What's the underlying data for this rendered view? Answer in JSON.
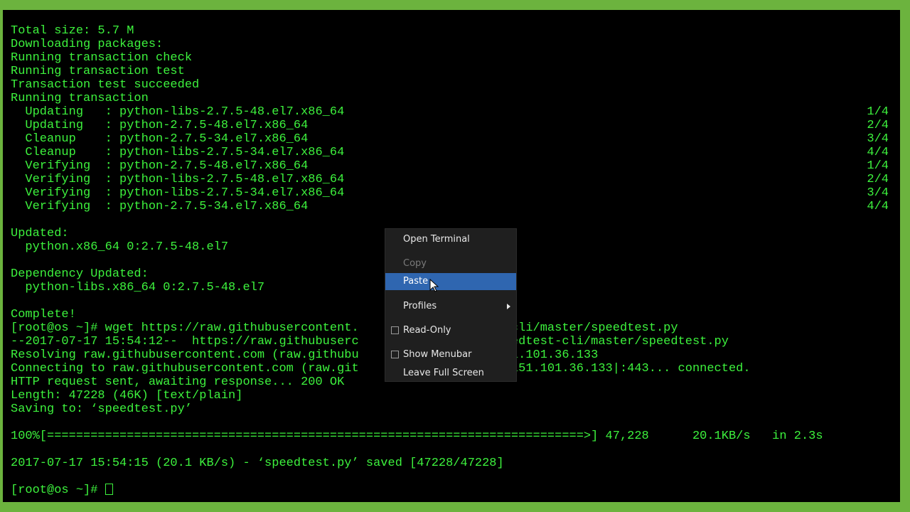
{
  "terminal": {
    "lines": [
      {
        "text": "Total size: 5.7 M",
        "right": ""
      },
      {
        "text": "Downloading packages:",
        "right": ""
      },
      {
        "text": "Running transaction check",
        "right": ""
      },
      {
        "text": "Running transaction test",
        "right": ""
      },
      {
        "text": "Transaction test succeeded",
        "right": ""
      },
      {
        "text": "Running transaction",
        "right": ""
      },
      {
        "text": "  Updating   : python-libs-2.7.5-48.el7.x86_64",
        "right": "1/4"
      },
      {
        "text": "  Updating   : python-2.7.5-48.el7.x86_64",
        "right": "2/4"
      },
      {
        "text": "  Cleanup    : python-2.7.5-34.el7.x86_64",
        "right": "3/4"
      },
      {
        "text": "  Cleanup    : python-libs-2.7.5-34.el7.x86_64",
        "right": "4/4"
      },
      {
        "text": "  Verifying  : python-2.7.5-48.el7.x86_64",
        "right": "1/4"
      },
      {
        "text": "  Verifying  : python-libs-2.7.5-48.el7.x86_64",
        "right": "2/4"
      },
      {
        "text": "  Verifying  : python-libs-2.7.5-34.el7.x86_64",
        "right": "3/4"
      },
      {
        "text": "  Verifying  : python-2.7.5-34.el7.x86_64",
        "right": "4/4"
      },
      {
        "text": "",
        "right": ""
      },
      {
        "text": "Updated:",
        "right": ""
      },
      {
        "text": "  python.x86_64 0:2.7.5-48.el7",
        "right": ""
      },
      {
        "text": "",
        "right": ""
      },
      {
        "text": "Dependency Updated:",
        "right": ""
      },
      {
        "text": "  python-libs.x86_64 0:2.7.5-48.el7",
        "right": ""
      },
      {
        "text": "",
        "right": ""
      },
      {
        "text": "Complete!",
        "right": ""
      },
      {
        "text": "[root@os ~]# wget https://raw.githubusercontent.                 est-cli/master/speedtest.py",
        "right": ""
      },
      {
        "text": "--2017-07-17 15:54:12--  https://raw.githubuserc                 /speedtest-cli/master/speedtest.py",
        "right": ""
      },
      {
        "text": "Resolving raw.githubusercontent.com (raw.githubu                 . 151.101.36.133",
        "right": ""
      },
      {
        "text": "Connecting to raw.githubusercontent.com (raw.git                 om)|151.101.36.133|:443... connected.",
        "right": ""
      },
      {
        "text": "HTTP request sent, awaiting response... 200 OK",
        "right": ""
      },
      {
        "text": "Length: 47228 (46K) [text/plain]",
        "right": ""
      },
      {
        "text": "Saving to: ‘speedtest.py’",
        "right": ""
      },
      {
        "text": "",
        "right": ""
      },
      {
        "text": "100%[==========================================================================>] 47,228      20.1KB/s   in 2.3s",
        "right": ""
      },
      {
        "text": "",
        "right": ""
      },
      {
        "text": "2017-07-17 15:54:15 (20.1 KB/s) - ‘speedtest.py’ saved [47228/47228]",
        "right": ""
      },
      {
        "text": "",
        "right": ""
      }
    ],
    "prompt": "[root@os ~]# "
  },
  "context_menu": {
    "items": [
      {
        "label": "Open Terminal"
      },
      {
        "label": "Copy"
      },
      {
        "label": "Paste"
      },
      {
        "label": "Profiles"
      },
      {
        "label": "Read-Only"
      },
      {
        "label": "Show Menubar"
      },
      {
        "label": "Leave Full Screen"
      }
    ]
  },
  "colors": {
    "terminal_fg": "#3df23d",
    "terminal_bg": "#000000",
    "frame": "#6cb33e",
    "menu_bg": "#1f1f1f",
    "menu_highlight": "#2f66b0"
  }
}
